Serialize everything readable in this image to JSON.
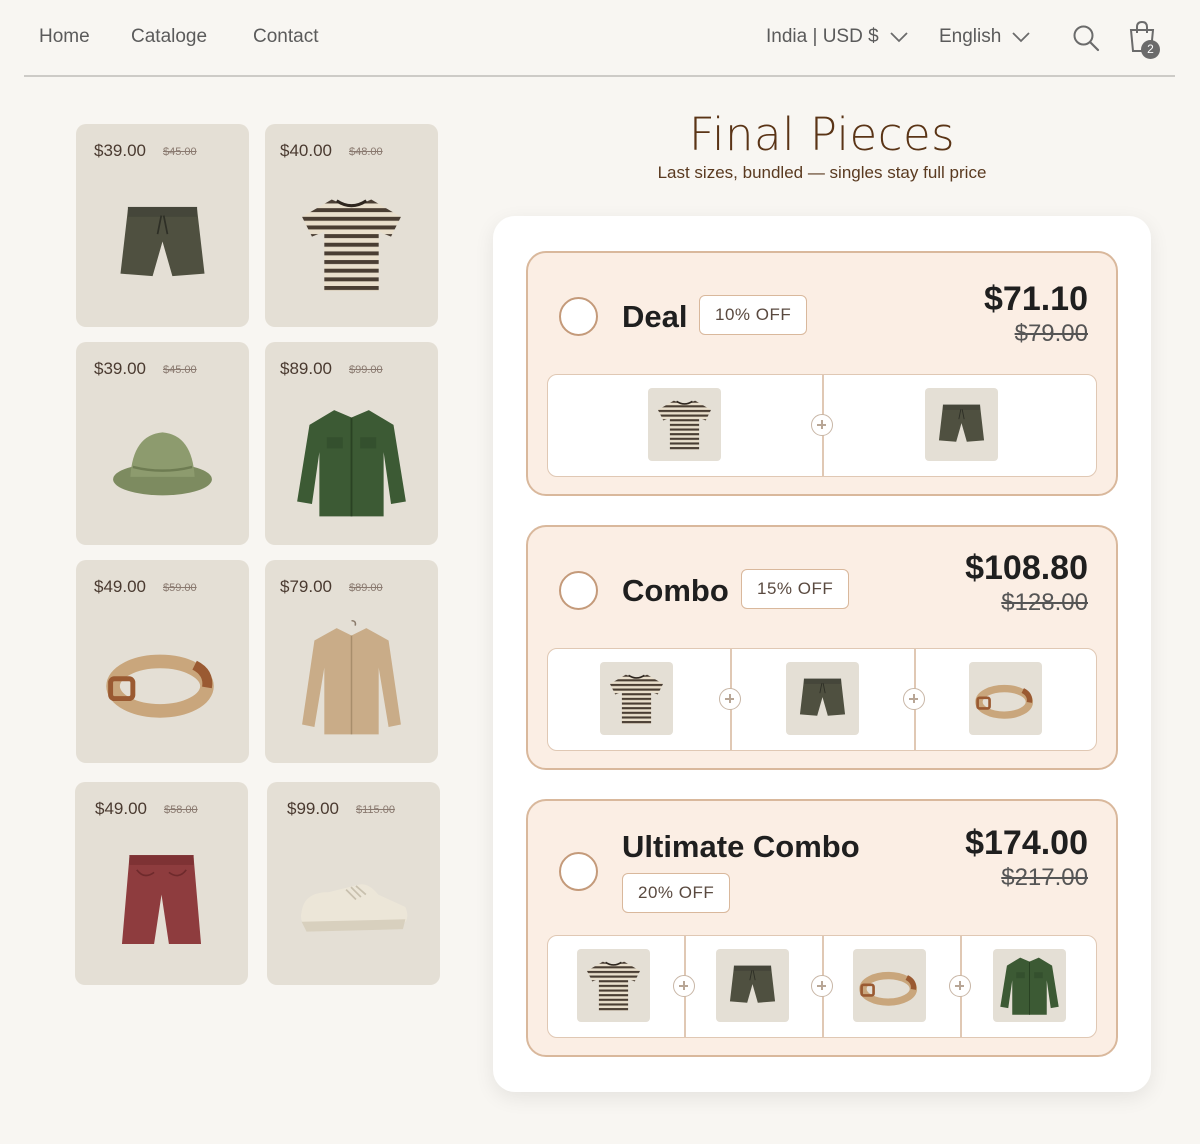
{
  "nav": {
    "links": [
      "Home",
      "Cataloge",
      "Contact"
    ],
    "currency": "India | USD $",
    "language": "English",
    "cart_count": "2"
  },
  "products": [
    {
      "price": "$39.00",
      "old": "$45.00",
      "item": "shorts-icon"
    },
    {
      "price": "$40.00",
      "old": "$48.00",
      "item": "striped-tee-icon"
    },
    {
      "price": "$39.00",
      "old": "$45.00",
      "item": "bucket-hat-icon"
    },
    {
      "price": "$89.00",
      "old": "$99.00",
      "item": "jacket-icon"
    },
    {
      "price": "$49.00",
      "old": "$59.00",
      "item": "belt-icon"
    },
    {
      "price": "$79.00",
      "old": "$89.00",
      "item": "shirt-icon"
    },
    {
      "price": "$49.00",
      "old": "$58.00",
      "item": "red-shorts-icon"
    },
    {
      "price": "$99.00",
      "old": "$115.00",
      "item": "sneaker-icon"
    }
  ],
  "header": {
    "title": "Final Pieces",
    "subtitle": "Last sizes, bundled — singles stay full price"
  },
  "bundles": [
    {
      "name": "Deal",
      "discount": "10% OFF",
      "price": "$71.10",
      "was": "$79.00",
      "items": [
        "striped-tee-icon",
        "shorts-icon"
      ]
    },
    {
      "name": "Combo",
      "discount": "15% OFF",
      "price": "$108.80",
      "was": "$128.00",
      "items": [
        "striped-tee-icon",
        "shorts-icon",
        "belt-icon"
      ]
    },
    {
      "name": "Ultimate Combo",
      "discount": "20% OFF",
      "price": "$174.00",
      "was": "$217.00",
      "items": [
        "striped-tee-icon",
        "shorts-icon",
        "belt-icon",
        "jacket-icon"
      ]
    }
  ],
  "colors": {
    "accent_brown": "#5a3416",
    "card_bg": "#fbeee4",
    "card_border": "#d9b89c",
    "tile_bg": "#e4dfd5"
  }
}
